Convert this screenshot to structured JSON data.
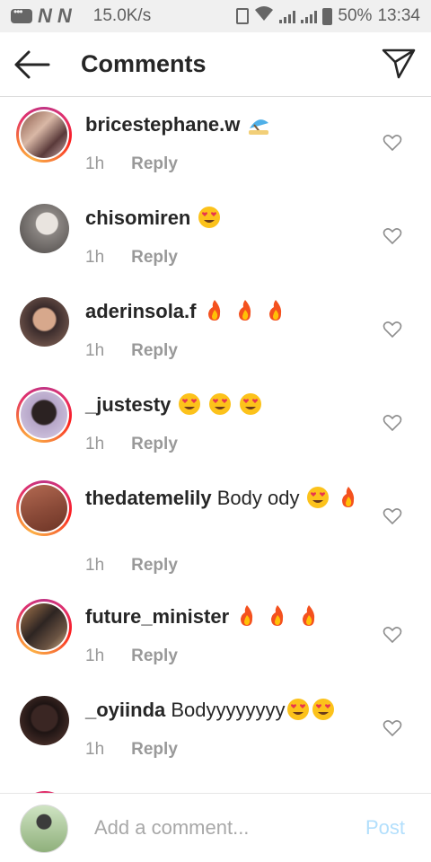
{
  "status_bar": {
    "speed": "15.0K/s",
    "battery": "50%",
    "time": "13:34"
  },
  "header": {
    "title": "Comments",
    "back_icon": "arrow-left-icon",
    "send_icon": "paper-plane-icon"
  },
  "comments": [
    {
      "username": "bricestephane.w",
      "text": "",
      "emojis": [
        "beach-umbrella"
      ],
      "time": "1h",
      "reply": "Reply"
    },
    {
      "username": "chisomiren",
      "text": "",
      "emojis": [
        "heart-eyes"
      ],
      "time": "1h",
      "reply": "Reply"
    },
    {
      "username": "aderinsola.f",
      "text": "",
      "emojis": [
        "fire",
        "fire",
        "fire"
      ],
      "time": "1h",
      "reply": "Reply"
    },
    {
      "username": "_justesty",
      "text": "",
      "emojis": [
        "heart-eyes",
        "heart-eyes",
        "heart-eyes"
      ],
      "time": "1h",
      "reply": "Reply"
    },
    {
      "username": "thedatemelily",
      "text": "Body ody",
      "emojis": [
        "heart-eyes",
        "fire"
      ],
      "time": "1h",
      "reply": "Reply"
    },
    {
      "username": "future_minister",
      "text": "",
      "emojis": [
        "fire",
        "fire",
        "fire"
      ],
      "time": "1h",
      "reply": "Reply"
    },
    {
      "username": "_oyiinda",
      "text": "Bodyyyyyyyy",
      "emojis": [
        "heart-eyes",
        "heart-eyes"
      ],
      "time": "1h",
      "reply": "Reply"
    }
  ],
  "composer": {
    "placeholder": "Add a comment...",
    "post_label": "Post"
  },
  "colors": {
    "text": "#262626",
    "meta": "#999999",
    "post_disabled": "#b2dffc",
    "story_ring": "#e1306c"
  }
}
